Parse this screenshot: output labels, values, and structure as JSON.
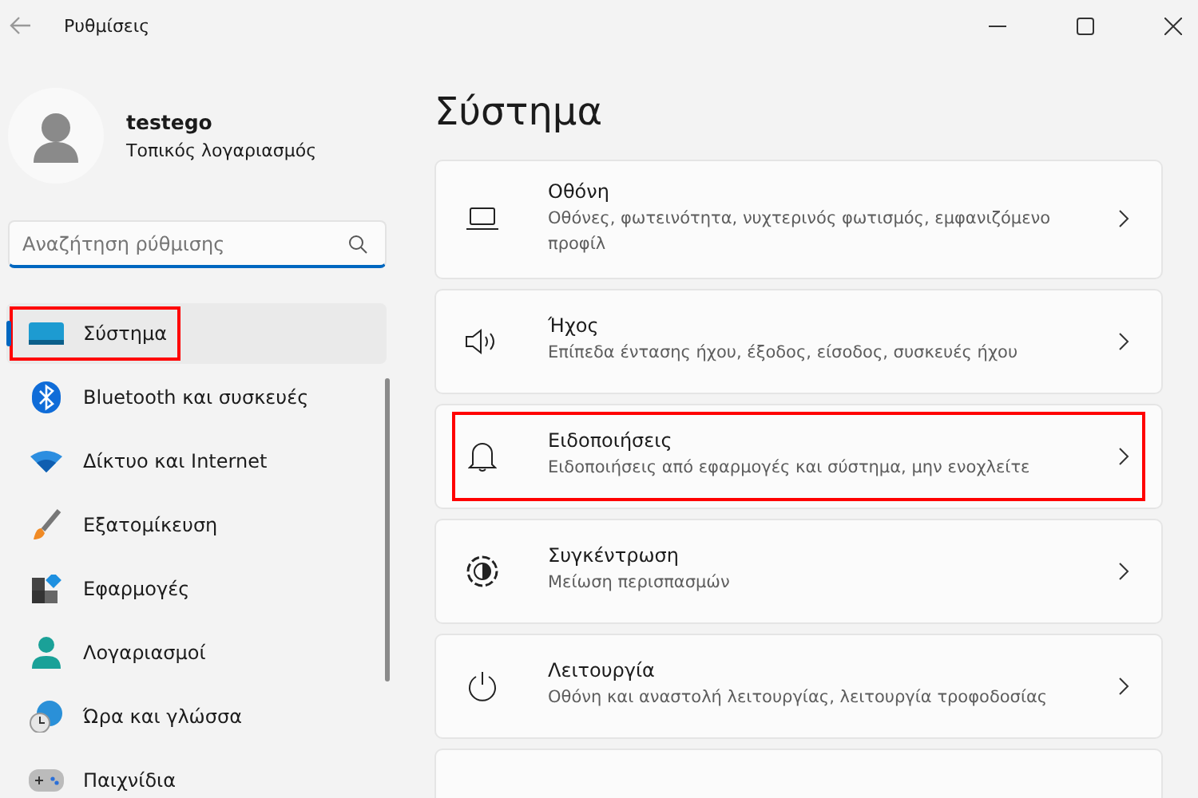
{
  "window": {
    "title": "Ρυθμίσεις"
  },
  "profile": {
    "name": "testego",
    "account": "Τοπικός λογαριασμός"
  },
  "search": {
    "placeholder": "Αναζήτηση ρύθμισης"
  },
  "sidebar": {
    "items": [
      {
        "label": "Σύστημα",
        "selected": true,
        "highlighted": true
      },
      {
        "label": "Bluetooth και συσκευές",
        "selected": false,
        "highlighted": false
      },
      {
        "label": "Δίκτυο και Internet",
        "selected": false,
        "highlighted": false
      },
      {
        "label": "Εξατομίκευση",
        "selected": false,
        "highlighted": false
      },
      {
        "label": "Εφαρμογές",
        "selected": false,
        "highlighted": false
      },
      {
        "label": "Λογαριασμοί",
        "selected": false,
        "highlighted": false
      },
      {
        "label": "Ώρα και γλώσσα",
        "selected": false,
        "highlighted": false
      },
      {
        "label": "Παιχνίδια",
        "selected": false,
        "highlighted": false
      }
    ]
  },
  "page": {
    "title": "Σύστημα"
  },
  "cards": [
    {
      "title": "Οθόνη",
      "description": "Οθόνες, φωτεινότητα, νυχτερινός φωτισμός, εμφανιζόμενο προφίλ",
      "highlighted": false
    },
    {
      "title": "Ήχος",
      "description": "Επίπεδα έντασης ήχου, έξοδος, είσοδος, συσκευές ήχου",
      "highlighted": false
    },
    {
      "title": "Ειδοποιήσεις",
      "description": "Ειδοποιήσεις από εφαρμογές και σύστημα, μην ενοχλείτε",
      "highlighted": true
    },
    {
      "title": "Συγκέντρωση",
      "description": "Μείωση περισπασμών",
      "highlighted": false
    },
    {
      "title": "Λειτουργία",
      "description": "Οθόνη και αναστολή λειτουργίας, λειτουργία τροφοδοσίας",
      "highlighted": false
    }
  ]
}
